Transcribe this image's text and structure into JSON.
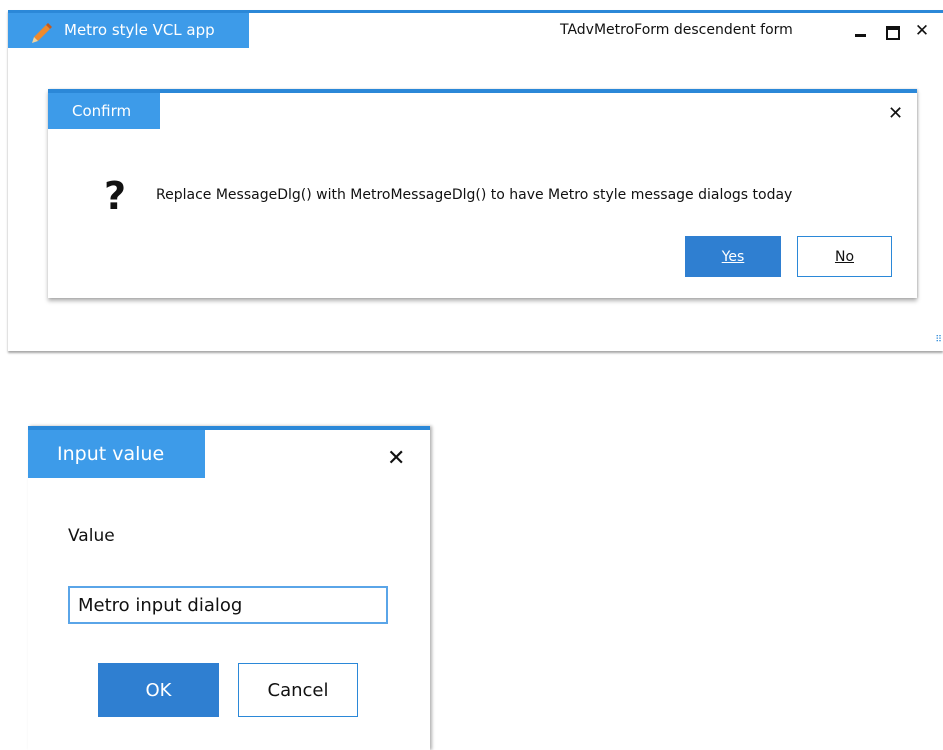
{
  "main_window": {
    "title": "Metro style VCL app",
    "caption": "TAdvMetroForm descendent form",
    "icon": "pencil-icon",
    "close_glyph": "✕",
    "grip": "⠿"
  },
  "confirm_dialog": {
    "title": "Confirm",
    "close_glyph": "✕",
    "icon_glyph": "?",
    "message": "Replace MessageDlg() with MetroMessageDlg() to have Metro style message dialogs today",
    "yes_label": "Yes",
    "no_label": "No"
  },
  "input_dialog": {
    "title": "Input value",
    "close_glyph": "✕",
    "field_label": "Value",
    "field_value": "Metro input dialog",
    "ok_label": "OK",
    "cancel_label": "Cancel"
  },
  "colors": {
    "accent": "#2b88d8",
    "tab": "#3d9be9",
    "primary_button": "#2f7fd1"
  }
}
